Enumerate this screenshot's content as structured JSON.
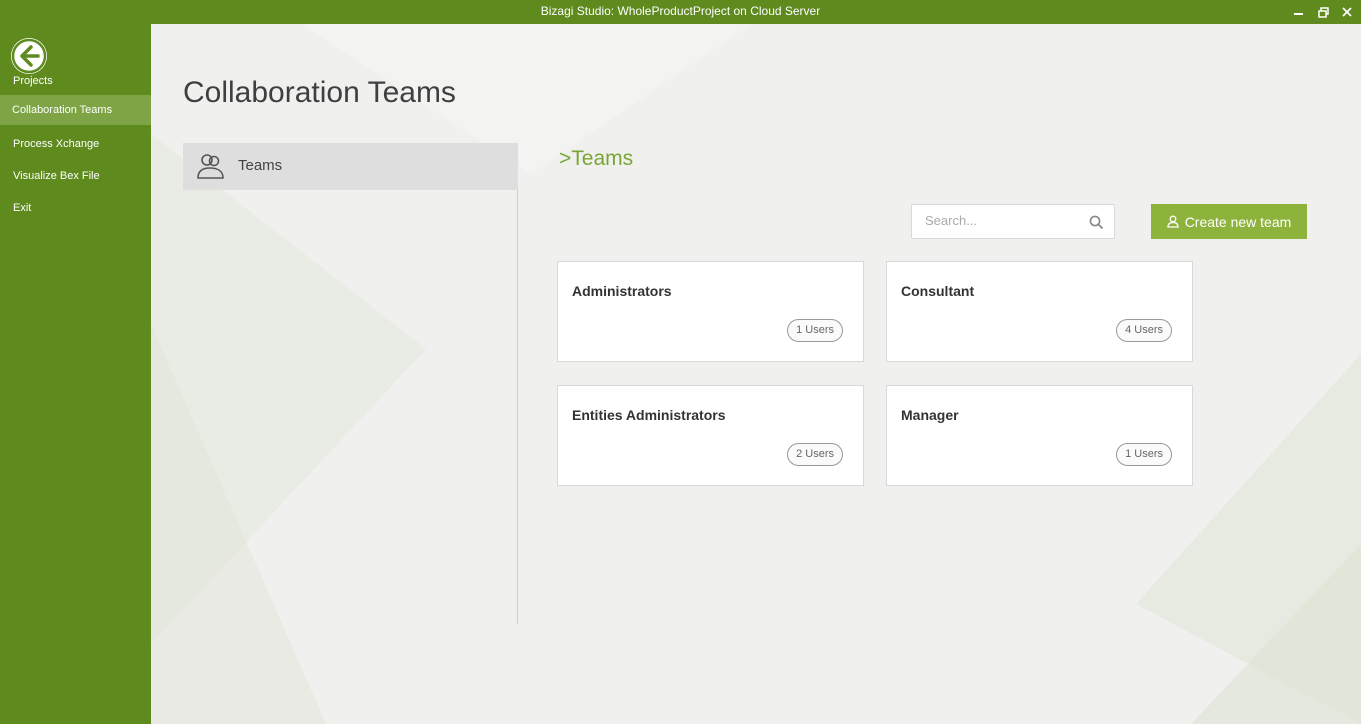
{
  "window": {
    "title": "Bizagi Studio: WholeProductProject  on Cloud Server"
  },
  "sidebar": {
    "items": [
      {
        "label": "Projects"
      },
      {
        "label": "Collaboration Teams"
      },
      {
        "label": "Process Xchange"
      },
      {
        "label": "Visualize Bex File"
      },
      {
        "label": "Exit"
      }
    ],
    "active": "Collaboration Teams"
  },
  "page": {
    "title": "Collaboration Teams"
  },
  "left_menu": {
    "items": [
      {
        "label": "Teams",
        "icon": "team-icon"
      }
    ]
  },
  "section": {
    "title": ">Teams"
  },
  "search": {
    "placeholder": "Search...",
    "value": ""
  },
  "create_button": {
    "label": "Create new team",
    "icon": "add-user-icon"
  },
  "teams": [
    {
      "name": "Administrators",
      "users": "1 Users"
    },
    {
      "name": "Consultant",
      "users": "4 Users"
    },
    {
      "name": "Entities Administrators",
      "users": "2 Users"
    },
    {
      "name": "Manager",
      "users": "1 Users"
    }
  ],
  "colors": {
    "brand": "#5e8a1e",
    "active_nav": "#7ea445",
    "accent": "#8db33d",
    "section_title": "#7aa536"
  }
}
